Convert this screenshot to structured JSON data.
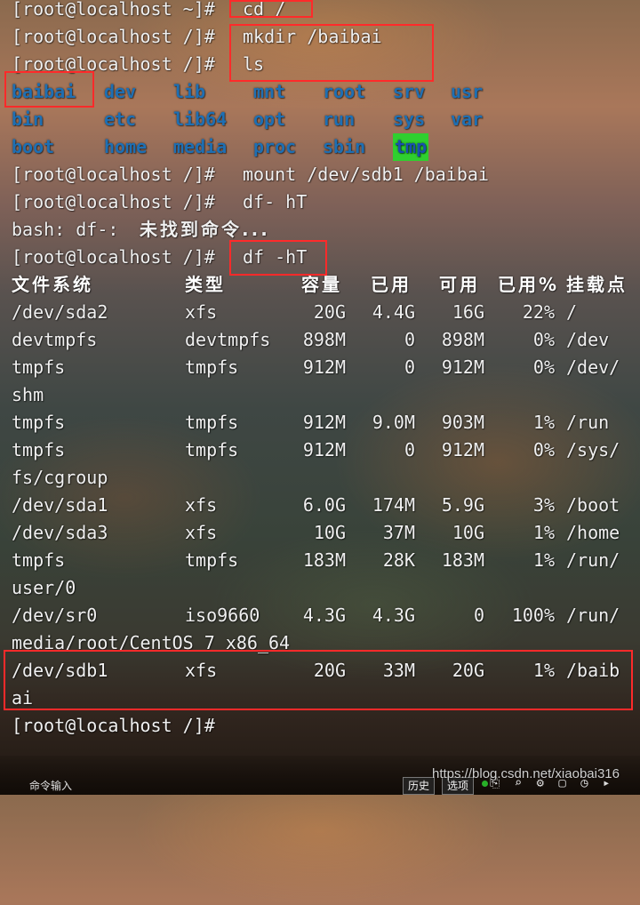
{
  "session": {
    "prompt": "[root@localhost /]# ",
    "prompt_home": "[root@localhost ~]# ",
    "cmd_cd": "cd /",
    "cmd_mkdir": "mkdir /baibai",
    "cmd_ls": "ls",
    "cmd_mount": "mount /dev/sdb1 /baibai",
    "cmd_bad": "df- hT",
    "error": "bash: df-: ",
    "error_cjk": "未找到命令...",
    "cmd_df": "df -hT"
  },
  "ls_output": [
    [
      "baibai",
      "dev",
      "lib",
      "mnt",
      "root",
      "srv",
      "usr"
    ],
    [
      "bin",
      "etc",
      "lib64",
      "opt",
      "run",
      "sys",
      "var"
    ],
    [
      "boot",
      "home",
      "media",
      "proc",
      "sbin",
      "tmp"
    ]
  ],
  "df_headers": [
    "文件系统",
    "类型",
    "容量",
    "已用",
    "可用",
    "已用%",
    "挂载点"
  ],
  "df_rows": [
    [
      "/dev/sda2",
      "xfs",
      "20G",
      "4.4G",
      "16G",
      "22%",
      "/"
    ],
    [
      "devtmpfs",
      "devtmpfs",
      "898M",
      "0",
      "898M",
      "0%",
      "/dev"
    ],
    [
      "tmpfs",
      "tmpfs",
      "912M",
      "0",
      "912M",
      "0%",
      "/dev/",
      "shm"
    ],
    [
      "tmpfs",
      "tmpfs",
      "912M",
      "9.0M",
      "903M",
      "1%",
      "/run"
    ],
    [
      "tmpfs",
      "tmpfs",
      "912M",
      "0",
      "912M",
      "0%",
      "/sys/",
      "fs/cgroup"
    ],
    [
      "/dev/sda1",
      "xfs",
      "6.0G",
      "174M",
      "5.9G",
      "3%",
      "/boot"
    ],
    [
      "/dev/sda3",
      "xfs",
      "10G",
      "37M",
      "10G",
      "1%",
      "/home"
    ],
    [
      "tmpfs",
      "tmpfs",
      "183M",
      "28K",
      "183M",
      "1%",
      "/run/",
      "user/0"
    ],
    [
      "/dev/sr0",
      "iso9660",
      "4.3G",
      "4.3G",
      "0",
      "100%",
      "/run/",
      "media/root/CentOS 7 x86_64"
    ],
    [
      "/dev/sdb1",
      "xfs",
      "20G",
      "33M",
      "20G",
      "1%",
      "/baib",
      "ai"
    ]
  ],
  "statusbar": {
    "input_label": "命令输入",
    "history_button": "历史",
    "options_button": "选项",
    "icons": "⎘ ⌕ ⚙ ▢ ◷ ▸"
  },
  "watermark": "https://blog.csdn.net/xiaobai316",
  "colors": {
    "text": "#f0f0f0",
    "directory": "#1e6fb3",
    "tmp_highlight_bg": "#2fcf2f",
    "annotation_box": "#ff2a2a"
  }
}
